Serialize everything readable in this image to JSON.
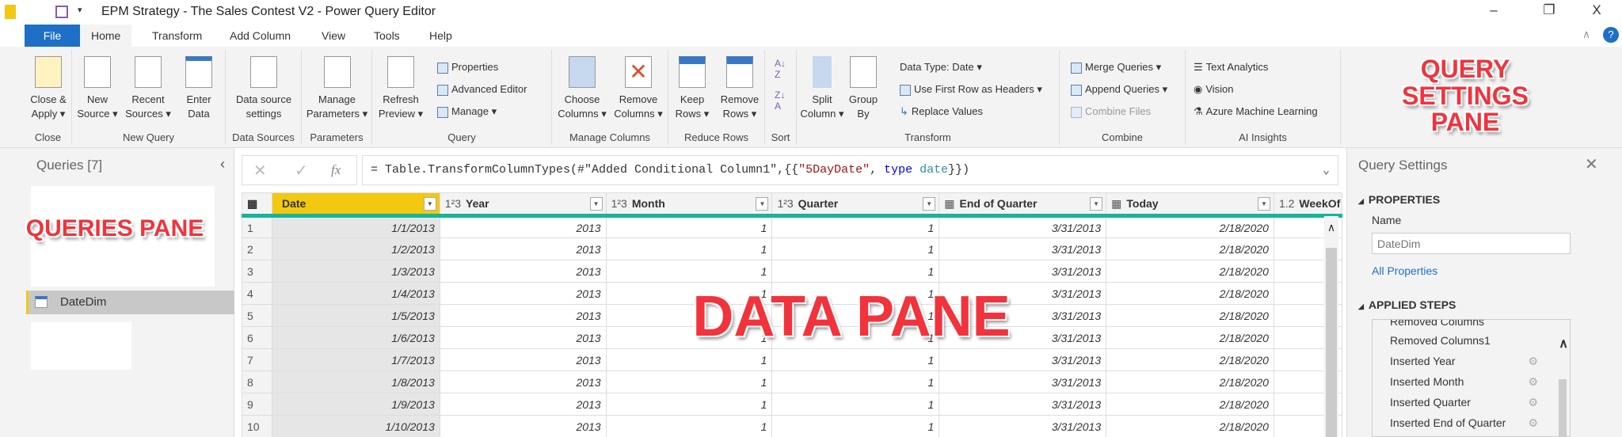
{
  "window": {
    "title": "EPM Strategy - The Sales Contest V2 - Power Query Editor",
    "minimize": "–",
    "restore": "❐",
    "close": "X"
  },
  "tabs": [
    "File",
    "Home",
    "Transform",
    "Add Column",
    "View",
    "Tools",
    "Help"
  ],
  "ribbon": {
    "close": {
      "label": "Close",
      "close_apply": "Close &",
      "close_apply2": "Apply ▾"
    },
    "new_query": {
      "label": "New Query",
      "new_source": [
        "New",
        "Source ▾"
      ],
      "recent": [
        "Recent",
        "Sources ▾"
      ],
      "enter": [
        "Enter",
        "Data"
      ]
    },
    "data_sources": {
      "label": "Data Sources",
      "settings": [
        "Data source",
        "settings"
      ]
    },
    "parameters": {
      "label": "Parameters",
      "manage": [
        "Manage",
        "Parameters ▾"
      ]
    },
    "query": {
      "label": "Query",
      "refresh": [
        "Refresh",
        "Preview ▾"
      ],
      "properties": "Properties",
      "advanced": "Advanced Editor",
      "manage": "Manage ▾"
    },
    "manage_columns": {
      "label": "Manage Columns",
      "choose": [
        "Choose",
        "Columns ▾"
      ],
      "remove": [
        "Remove",
        "Columns ▾"
      ]
    },
    "reduce_rows": {
      "label": "Reduce Rows",
      "keep": [
        "Keep",
        "Rows ▾"
      ],
      "remove": [
        "Remove",
        "Rows ▾"
      ]
    },
    "sort": {
      "label": "Sort"
    },
    "transform": {
      "label": "Transform",
      "split": [
        "Split",
        "Column ▾"
      ],
      "group": [
        "Group",
        "By"
      ],
      "data_type": "Data Type: Date ▾",
      "first_row": "Use First Row as Headers ▾",
      "replace": "Replace Values"
    },
    "combine": {
      "label": "Combine",
      "merge": "Merge Queries ▾",
      "append": "Append Queries ▾",
      "files": "Combine Files"
    },
    "ai": {
      "label": "AI Insights",
      "text": "Text Analytics",
      "vision": "Vision",
      "azure": "Azure Machine Learning"
    }
  },
  "annotations": {
    "queries": "QUERIES PANE",
    "data": "DATA PANE",
    "settings": "QUERY SETTINGS PANE"
  },
  "queries": {
    "title": "Queries [7]",
    "items": [
      "DateDim"
    ]
  },
  "formula": {
    "prefix": "= Table.TransformColumnTypes(#\"Added Conditional Column1\",{{",
    "str": "\"5DayDate\"",
    "comma": ", ",
    "kw": "type",
    "ty": " date",
    "end": "}})",
    "fx": "fx"
  },
  "grid": {
    "columns": [
      {
        "type": "",
        "name": "Date"
      },
      {
        "type": "1²3",
        "name": "Year"
      },
      {
        "type": "1²3",
        "name": "Month"
      },
      {
        "type": "1²3",
        "name": "Quarter"
      },
      {
        "type": "▦",
        "name": "End of Quarter"
      },
      {
        "type": "▦",
        "name": "Today"
      },
      {
        "type": "1.2",
        "name": "WeekOf"
      }
    ],
    "rows": [
      [
        "1",
        "1/1/2013",
        "2013",
        "1",
        "1",
        "3/31/2013",
        "2/18/2020"
      ],
      [
        "2",
        "1/2/2013",
        "2013",
        "1",
        "1",
        "3/31/2013",
        "2/18/2020"
      ],
      [
        "3",
        "1/3/2013",
        "2013",
        "1",
        "1",
        "3/31/2013",
        "2/18/2020"
      ],
      [
        "4",
        "1/4/2013",
        "2013",
        "1",
        "1",
        "3/31/2013",
        "2/18/2020"
      ],
      [
        "5",
        "1/5/2013",
        "2013",
        "1",
        "1",
        "3/31/2013",
        "2/18/2020"
      ],
      [
        "6",
        "1/6/2013",
        "2013",
        "1",
        "1",
        "3/31/2013",
        "2/18/2020"
      ],
      [
        "7",
        "1/7/2013",
        "2013",
        "1",
        "1",
        "3/31/2013",
        "2/18/2020"
      ],
      [
        "8",
        "1/8/2013",
        "2013",
        "1",
        "1",
        "3/31/2013",
        "2/18/2020"
      ],
      [
        "9",
        "1/9/2013",
        "2013",
        "1",
        "1",
        "3/31/2013",
        "2/18/2020"
      ],
      [
        "10",
        "1/10/2013",
        "2013",
        "1",
        "1",
        "3/31/2013",
        "2/18/2020"
      ]
    ]
  },
  "settings": {
    "title": "Query Settings",
    "properties": "PROPERTIES",
    "name_label": "Name",
    "name_value": "DateDim",
    "all_properties": "All Properties",
    "applied_steps": "APPLIED STEPS",
    "steps": [
      "Removed Columns",
      "Removed Columns1",
      "Inserted Year",
      "Inserted Month",
      "Inserted Quarter",
      "Inserted End of Quarter"
    ]
  }
}
